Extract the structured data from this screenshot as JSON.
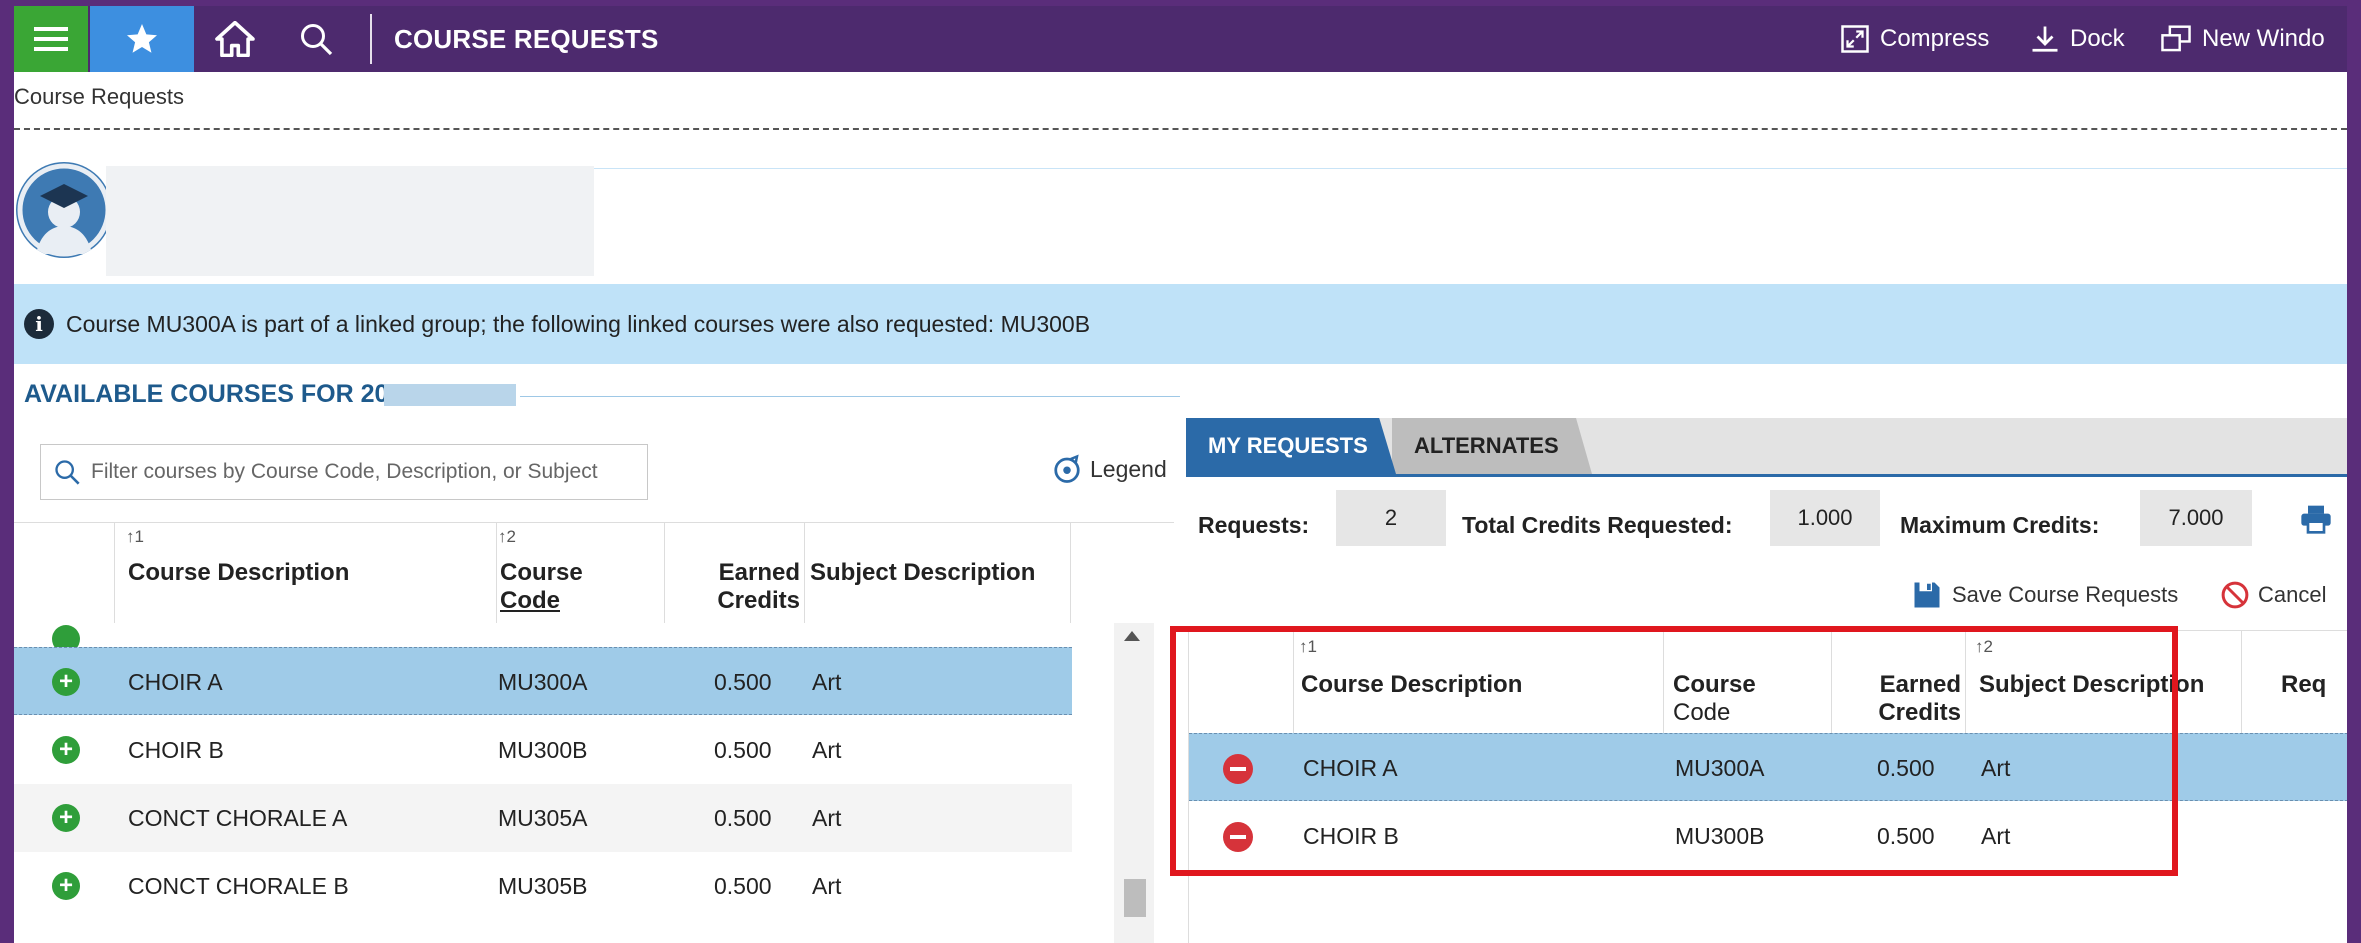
{
  "header": {
    "title": "COURSE REQUESTS",
    "actions": {
      "compress": "Compress",
      "dock": "Dock",
      "new_window": "New Windo"
    }
  },
  "breadcrumb": "Course Requests",
  "banner": {
    "message": "Course MU300A is part of a linked group; the following linked courses were also requested: MU300B"
  },
  "available": {
    "title": "AVAILABLE COURSES FOR 20",
    "filter_placeholder": "Filter courses by Course Code, Description, or Subject",
    "legend": "Legend",
    "columns": {
      "description": "Course Description",
      "code_line1": "Course",
      "code_line2": "Code",
      "credits_line1": "Earned",
      "credits_line2": "Credits",
      "subject": "Subject Description",
      "sort1": "1",
      "sort2": "2"
    },
    "rows": [
      {
        "description": "CHOIR A",
        "code": "MU300A",
        "credits": "0.500",
        "subject": "Art"
      },
      {
        "description": "CHOIR B",
        "code": "MU300B",
        "credits": "0.500",
        "subject": "Art"
      },
      {
        "description": "CONCT CHORALE A",
        "code": "MU305A",
        "credits": "0.500",
        "subject": "Art"
      },
      {
        "description": "CONCT CHORALE B",
        "code": "MU305B",
        "credits": "0.500",
        "subject": "Art"
      }
    ]
  },
  "tabs": {
    "my_requests": "MY REQUESTS",
    "alternates": "ALTERNATES"
  },
  "summary": {
    "requests_label": "Requests:",
    "requests_value": "2",
    "total_label": "Total Credits Requested:",
    "total_value": "1.000",
    "max_label": "Maximum Credits:",
    "max_value": "7.000"
  },
  "actions": {
    "save": "Save Course Requests",
    "cancel": "Cancel"
  },
  "requests": {
    "columns": {
      "description": "Course Description",
      "code_line1": "Course",
      "code_line2": "Code",
      "credits_line1": "Earned",
      "credits_line2": "Credits",
      "subject": "Subject Description",
      "extra": "Req",
      "sort1": "1",
      "sort2": "2"
    },
    "rows": [
      {
        "description": "CHOIR A",
        "code": "MU300A",
        "credits": "0.500",
        "subject": "Art"
      },
      {
        "description": "CHOIR B",
        "code": "MU300B",
        "credits": "0.500",
        "subject": "Art"
      }
    ]
  },
  "colors": {
    "header_bg": "#4d2a6e",
    "menu_green": "#3aa635",
    "star_blue": "#3d8fe0",
    "banner_bg": "#bfe2f8",
    "selected_row": "#9fcbe8",
    "tab_active": "#2b6aa8",
    "add_green": "#2f9e3a",
    "remove_red": "#d6333a",
    "highlight_red": "#e0171e"
  }
}
